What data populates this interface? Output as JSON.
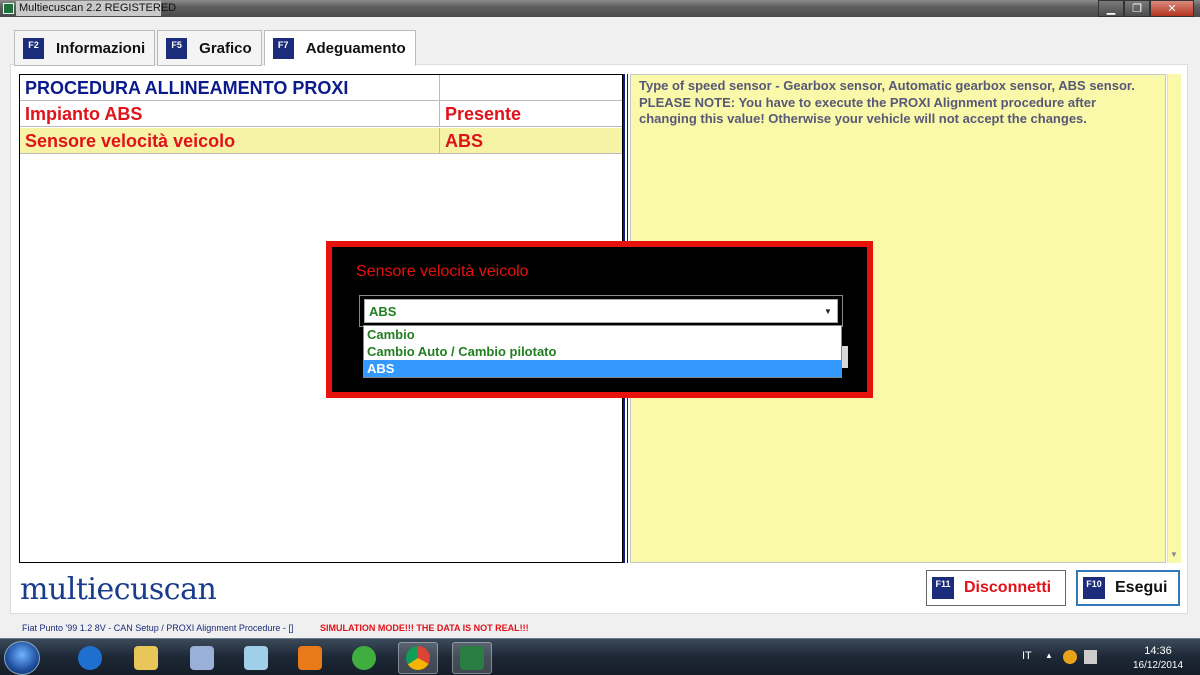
{
  "window": {
    "title": "Multiecuscan 2.2 REGISTERED",
    "controls": [
      "▁",
      "❐",
      "✕"
    ]
  },
  "tabs": [
    {
      "key": "F2",
      "label": "Informazioni",
      "active": false
    },
    {
      "key": "F5",
      "label": "Grafico",
      "active": false
    },
    {
      "key": "F7",
      "label": "Adeguamento",
      "active": true
    }
  ],
  "params": {
    "header": "PROCEDURA ALLINEAMENTO PROXI",
    "rows": [
      {
        "name": "Impianto ABS",
        "value": "Presente"
      },
      {
        "name": "Sensore velocità veicolo",
        "value": "ABS",
        "selected": true
      }
    ]
  },
  "help": {
    "text": "Type of speed sensor - Gearbox sensor, Automatic gearbox sensor, ABS sensor.\nPLEASE NOTE: You have to execute the PROXI Alignment procedure after changing this value! Otherwise your vehicle will not accept the changes."
  },
  "modal": {
    "title": "Sensore velocità veicolo",
    "selected_value": "ABS",
    "options": [
      "Cambio",
      "Cambio Auto / Cambio pilotato",
      "ABS"
    ],
    "highlighted_option": "ABS"
  },
  "logo": "multiecuscan",
  "buttons": {
    "disconnect": {
      "key": "F11",
      "label": "Disconnetti"
    },
    "execute": {
      "key": "F10",
      "label": "Esegui"
    }
  },
  "status": {
    "vehicle": "Fiat Punto '99 1.2 8V - CAN Setup / PROXI Alignment Procedure - []",
    "warning": "SIMULATION MODE!!! THE DATA IS NOT REAL!!!"
  },
  "taskbar": {
    "icons": [
      "windows-start-icon",
      "accessibility-icon",
      "file-explorer-icon",
      "control-panel-icon",
      "notepad-icon",
      "media-player-icon",
      "fiat-app-icon",
      "chrome-icon",
      "multiecuscan-icon"
    ],
    "language": "IT",
    "time": "14:36",
    "date": "16/12/2014"
  },
  "colors": {
    "accent_red": "#e0121a",
    "header_blue": "#0b1a8c",
    "help_bg": "#f9f9a9",
    "option_green": "#227e22",
    "highlight_blue": "#3399ff"
  }
}
